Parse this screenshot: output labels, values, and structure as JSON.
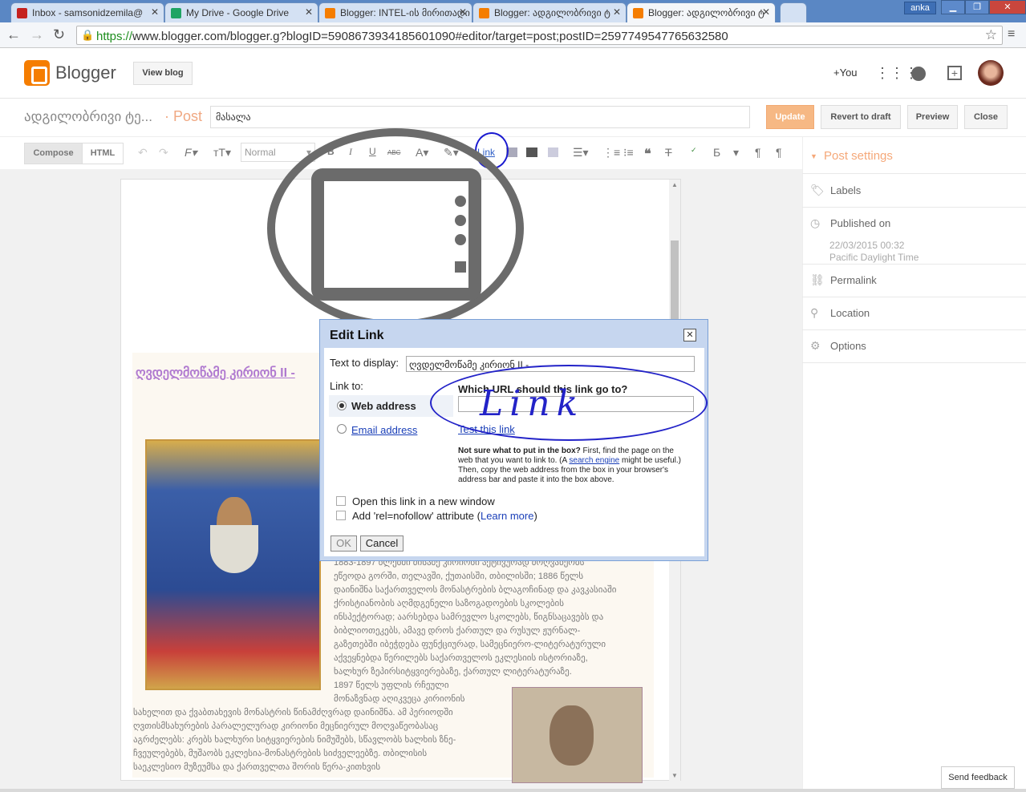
{
  "browser": {
    "tabs": [
      {
        "label": "Inbox - samsonidzemila@",
        "color": "#c5221f"
      },
      {
        "label": "My Drive - Google Drive",
        "color": "#1fa463"
      },
      {
        "label": "Blogger: INTEL-ის მირითადი",
        "color": "#f57d00"
      },
      {
        "label": "Blogger: ადგილობრივი ტ",
        "color": "#f57d00"
      },
      {
        "label": "Blogger: ადგილობრივი ტ",
        "color": "#f57d00"
      }
    ],
    "user": "anka",
    "url_secure": "https://",
    "url_rest": "www.blogger.com/blogger.g?blogID=5908673934185601090#editor/target=post;postID=2597749547765632580"
  },
  "blogger": {
    "brand": "Blogger",
    "view_blog": "View blog",
    "plus_you": "+You",
    "blog_name": "ადგილობრივი ტე...",
    "post_sep": "· Post",
    "post_title": "მასალა",
    "update": "Update",
    "revert": "Revert to draft",
    "preview": "Preview",
    "close": "Close"
  },
  "toolbar": {
    "compose": "Compose",
    "html": "HTML",
    "font_size": "Normal",
    "bold": "B",
    "italic": "I",
    "underline": "U",
    "strike": "ABC",
    "link": "Link",
    "georgian": "Б",
    "pilcrow": "¶"
  },
  "editor": {
    "headline": "ღვდელმოწამე კირიონ II -",
    "para1": [
      "1883-1897 წლებში მისამე კირიონი აქტივურად მოღვაწეობს",
      "ეწეოდა გორში, თელავში, ქუთაისში, თბილისში; 1886 წელს",
      "დაინიშნა საქართველოს მონასტრების ბლაგოჩინად და კავკასიაში",
      "ქრისტიანობის აღმდგენელი საზოგადოების სკოლების",
      "ინსპექტორად; აარსებდა სამრევლო სკოლებს, წიგნსაცავებს და",
      "ბიბლიოთეკებს, ამავე დროს ქართულ და რუსულ ჟურნალ-",
      "გაზეთებში იბეჭდება ფუნქციურად, სამეცნიერო-ლიტერატურული",
      "აქვეყნებდა წერილებს საქართველოს ეკლესიის ისტორიაზე,",
      "ხალხურ ზეპირსიტყვიერებაზე, ქართულ ლიტერატურაზე.",
      "1897 წელს უფლის რჩეული"
    ],
    "para2": [
      "მონაზვნად აღიკვეცა კირიონის",
      "სახელით და ქვაბთახევის მონასტრის წინამძღვრად დაინიშნა. ამ პერიოდში",
      "ღვთისმსახურების პარალელურად კირიონი მეცნიერულ მოღვაწეობასაც",
      "აგრძელებს: კრებს ხალხური სიტყვიერების ნიმუშებს, სწავლობს ხალხის ზნე-",
      "ჩვეულებებს, მუშაობს ეკლესია-მონასტრების სიძველეებზე. თბილისის",
      "საეკლესიო მუზეუმსა და ქართველთა შორის წერა-კითხვის"
    ]
  },
  "sidebar": {
    "post_settings": "Post settings",
    "labels": "Labels",
    "published_on": "Published on",
    "published_date": "22/03/2015 00:32",
    "published_tz": "Pacific Daylight Time",
    "permalink": "Permalink",
    "location": "Location",
    "options": "Options"
  },
  "dialog": {
    "title": "Edit Link",
    "text_to_display_label": "Text to display:",
    "text_to_display_value": "ღვდელმოწამე კირიონ II -",
    "link_to_label": "Link to:",
    "web_address": "Web address",
    "email_address": "Email address",
    "question": "Which URL should this link go to?",
    "test_link": "Test this link",
    "help_bold": "Not sure what to put in the box?",
    "help_1": " First, find the page on the web that you want to link to. (A ",
    "help_link": "search engine",
    "help_2": " might be useful.) Then, copy the web address from the box in your browser's address bar and paste it into the box above.",
    "open_new_window": "Open this link in a new window",
    "nofollow_1": "Add 'rel=nofollow' attribute (",
    "learn_more": "Learn more",
    "nofollow_2": ")",
    "ok": "OK",
    "cancel": "Cancel",
    "scrawl": "Link"
  },
  "footer": {
    "send_feedback": "Send feedback"
  }
}
